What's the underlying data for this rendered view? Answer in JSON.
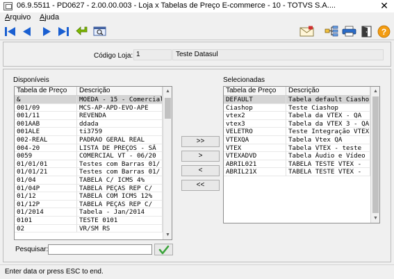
{
  "window": {
    "title": "06.9.5511 - PD0627 - 2.00.00.003 - Loja x Tabelas de Preço E-commerce - 10 - TOTVS S.A....",
    "close": "✕"
  },
  "menu": [
    {
      "label_u": "A",
      "label_rest": "rquivo"
    },
    {
      "label_u": "A",
      "label_rest": "juda"
    }
  ],
  "toolbar": {
    "left": [
      "first-record-icon",
      "previous-record-icon",
      "next-record-icon",
      "last-record-icon",
      "back-icon",
      "search-window-icon"
    ],
    "right": [
      "email-icon",
      "tree-icon",
      "print-icon",
      "exit-door-icon",
      "help-icon"
    ]
  },
  "header": {
    "code_label": "Código Loja:",
    "code_value": "1",
    "store_name": "Teste Datasul"
  },
  "available": {
    "title": "Disponíveis",
    "columns": [
      "Tabela de Preço",
      "Descrição"
    ],
    "rows": [
      [
        "&",
        "MOEDA - 15 - Comercial"
      ],
      [
        "001/09",
        "MCS-AP-APD-EVO-APE"
      ],
      [
        "001/11",
        "REVENDA"
      ],
      [
        "001AAB",
        "ddada"
      ],
      [
        "001ALE",
        "ti3759"
      ],
      [
        "002-REAL",
        "PADRAO GERAL REAL"
      ],
      [
        "004-20",
        "LISTA DE PREÇOS - SÃ"
      ],
      [
        "0059",
        "COMERCIAL VT - 06/20"
      ],
      [
        "01/01/01",
        "Testes com Barras 01/"
      ],
      [
        "01/01/21",
        "Testes com Barras 01/"
      ],
      [
        "01/04",
        "TABELA C/ ICMS 4%"
      ],
      [
        "01/04P",
        "TABELA PEÇAS REP C/"
      ],
      [
        "01/12",
        "TABELA COM ICMS 12%"
      ],
      [
        "01/12P",
        "TABELA PEÇAS REP C/"
      ],
      [
        "01/2014",
        "Tabela - Jan/2014"
      ],
      [
        "0101",
        "TESTE 0101"
      ],
      [
        "02",
        "VR/SM RS"
      ]
    ]
  },
  "selected": {
    "title": "Selecionadas",
    "columns": [
      "Tabela de Preço",
      "Descrição"
    ],
    "rows": [
      [
        "DEFAULT",
        "Tabela default Ciashop"
      ],
      [
        "Ciashop",
        "Teste Ciashop"
      ],
      [
        "vtex2",
        "Tabela da VTEX - QA"
      ],
      [
        "vtex3",
        "Tabela da VTEX 3 - QA"
      ],
      [
        "VELETRO",
        "Teste Integração VTEX"
      ],
      [
        "VTEXQA",
        "Tabela Vtex QA"
      ],
      [
        "VTEX",
        "Tabela VTEX - teste"
      ],
      [
        "VTEXADVD",
        "Tabela Áudio e Vídeo"
      ],
      [
        "ABRIL021",
        "TABELA TESTE VTEX -"
      ],
      [
        "ABRIL21X",
        "TABELA TESTE VTEX -"
      ]
    ]
  },
  "buttons": {
    "add_all": ">>",
    "add": ">",
    "remove": "<",
    "remove_all": "<<"
  },
  "search": {
    "label": "Pesquisar:",
    "value": "",
    "placeholder": ""
  },
  "status": {
    "text": "Enter data or press ESC to end."
  },
  "colors": {
    "blue_nav": "#1a5fd1",
    "green_check": "#3aa33a",
    "help_orange": "#f39c12",
    "selected_row": "#d4d4d4"
  }
}
